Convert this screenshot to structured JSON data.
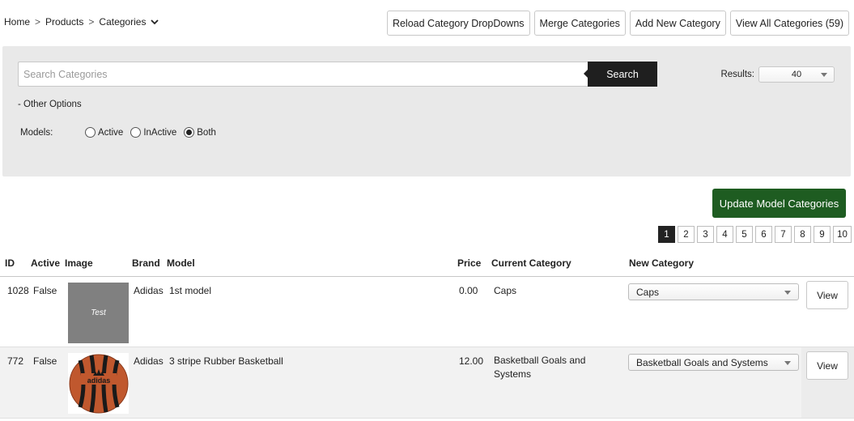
{
  "breadcrumb": {
    "home": "Home",
    "products": "Products",
    "categories": "Categories",
    "separator": ">"
  },
  "top_buttons": {
    "reload": "Reload Category DropDowns",
    "merge": "Merge Categories",
    "add": "Add New Category",
    "view_all": "View All Categories (59)"
  },
  "search": {
    "placeholder": "Search Categories",
    "value": "",
    "button": "Search"
  },
  "results": {
    "label": "Results:",
    "value": "40"
  },
  "other_options": "- Other Options",
  "models": {
    "label": "Models:",
    "options": [
      {
        "label": "Active",
        "checked": false
      },
      {
        "label": "InActive",
        "checked": false
      },
      {
        "label": "Both",
        "checked": true
      }
    ]
  },
  "update_button": "Update Model Categories",
  "pagination": {
    "pages": [
      "1",
      "2",
      "3",
      "4",
      "5",
      "6",
      "7",
      "8",
      "9",
      "10"
    ],
    "active": "1"
  },
  "table": {
    "headers": {
      "id": "ID",
      "active": "Active",
      "image": "Image",
      "brand": "Brand",
      "model": "Model",
      "price": "Price",
      "current_category": "Current Category",
      "new_category": "New Category"
    },
    "rows": [
      {
        "id": "1028",
        "active": "False",
        "image_text": "Test",
        "brand": "Adidas",
        "model": "1st model",
        "price": "0.00",
        "current_category": "Caps",
        "new_category": "Caps",
        "view": "View"
      },
      {
        "id": "772",
        "active": "False",
        "image_text": "adidas",
        "brand": "Adidas",
        "model": "3 stripe Rubber Basketball",
        "price": "12.00",
        "current_category_line1": "Basketball Goals and",
        "current_category_line2": "Systems",
        "new_category": "Basketball Goals and Systems",
        "view": "View"
      }
    ]
  },
  "colors": {
    "update_green": "#1e5c21",
    "search_black": "#1f1f1f",
    "panel_gray": "#e9e9e9",
    "ball_orange": "#c0582e"
  }
}
